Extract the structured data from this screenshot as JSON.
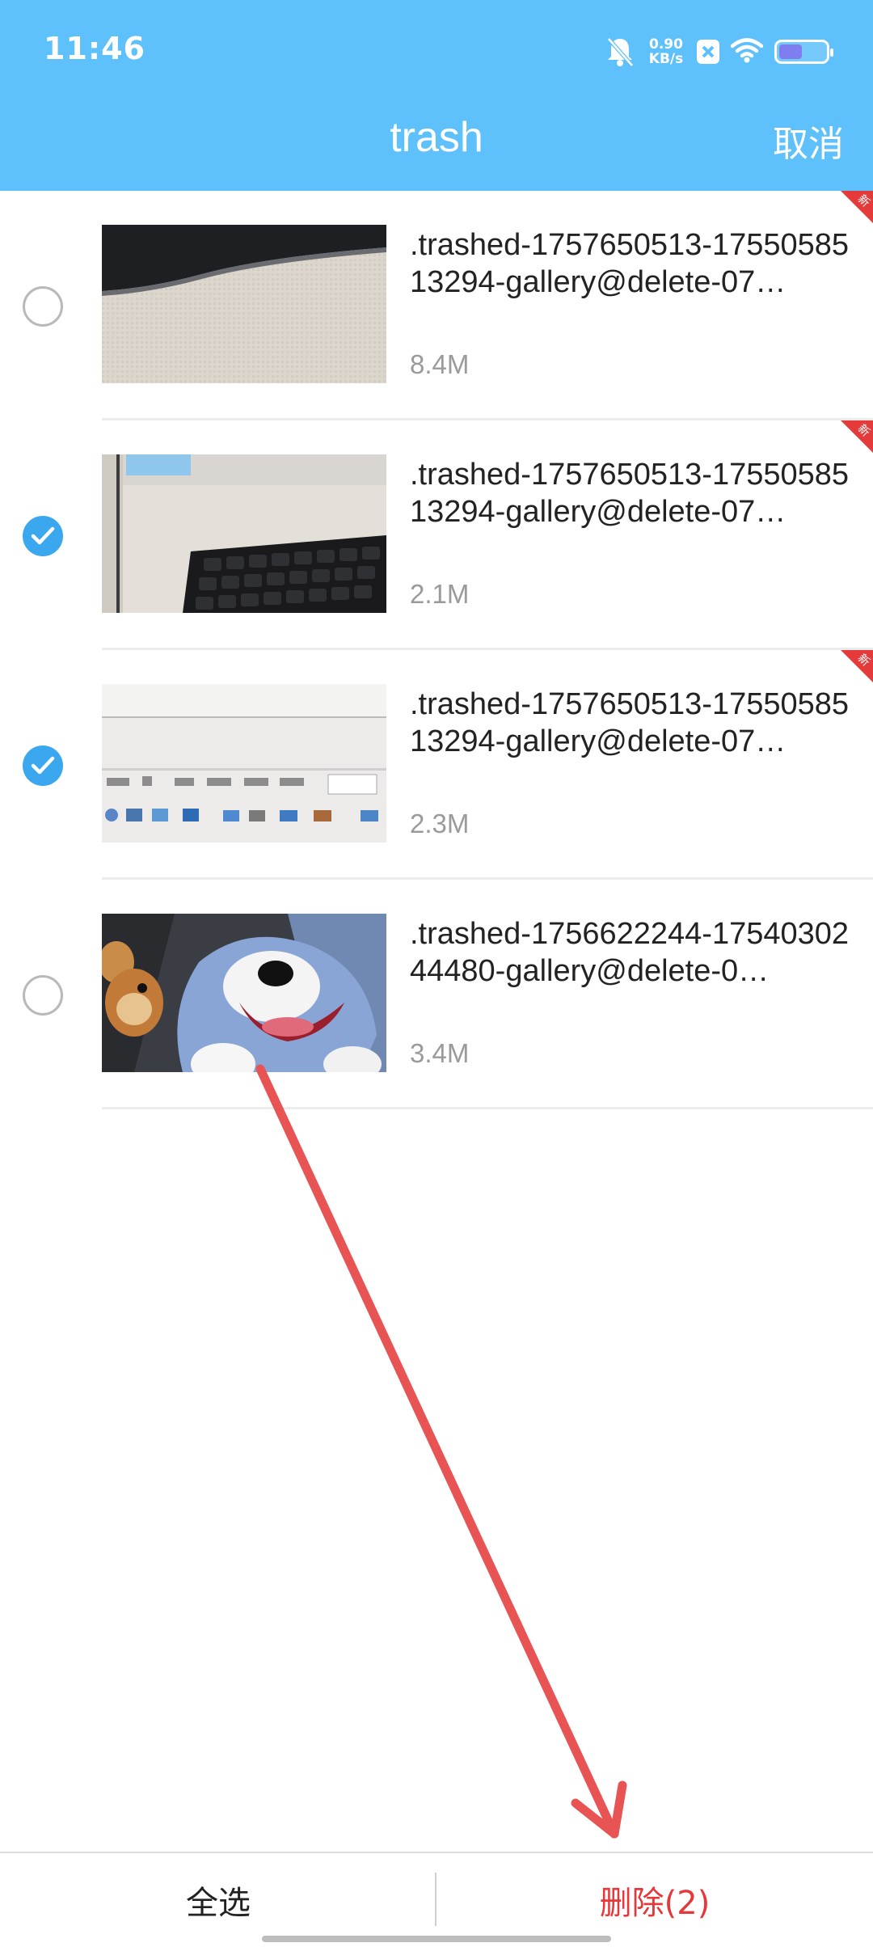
{
  "status_bar": {
    "time": "11:46",
    "net_speed_value": "0.90",
    "net_speed_unit": "KB/s",
    "battery_level": 0.45,
    "icons": [
      "bell-off-icon",
      "x-app-icon",
      "wifi-icon",
      "battery-icon"
    ]
  },
  "header": {
    "title": "trash",
    "cancel_label": "取消"
  },
  "files": [
    {
      "name": ".trashed-1757650513-1755058513294-gallery@delete-07…",
      "size": "8.4M",
      "selected": false,
      "new_badge": "新"
    },
    {
      "name": ".trashed-1757650513-1755058513294-gallery@delete-07…",
      "size": "2.1M",
      "selected": true,
      "new_badge": "新"
    },
    {
      "name": ".trashed-1757650513-1755058513294-gallery@delete-07…",
      "size": "2.3M",
      "selected": true,
      "new_badge": "新"
    },
    {
      "name": ".trashed-1756622244-1754030244480-gallery@delete-0…",
      "size": "3.4M",
      "selected": false,
      "new_badge": ""
    }
  ],
  "bottom_bar": {
    "select_all_label": "全选",
    "delete_label": "删除(2)"
  },
  "colors": {
    "header_bg": "#5fc1fb",
    "accent_blue": "#3ba7ef",
    "delete_red": "#e5383b",
    "annotation_arrow": "#e85454"
  }
}
